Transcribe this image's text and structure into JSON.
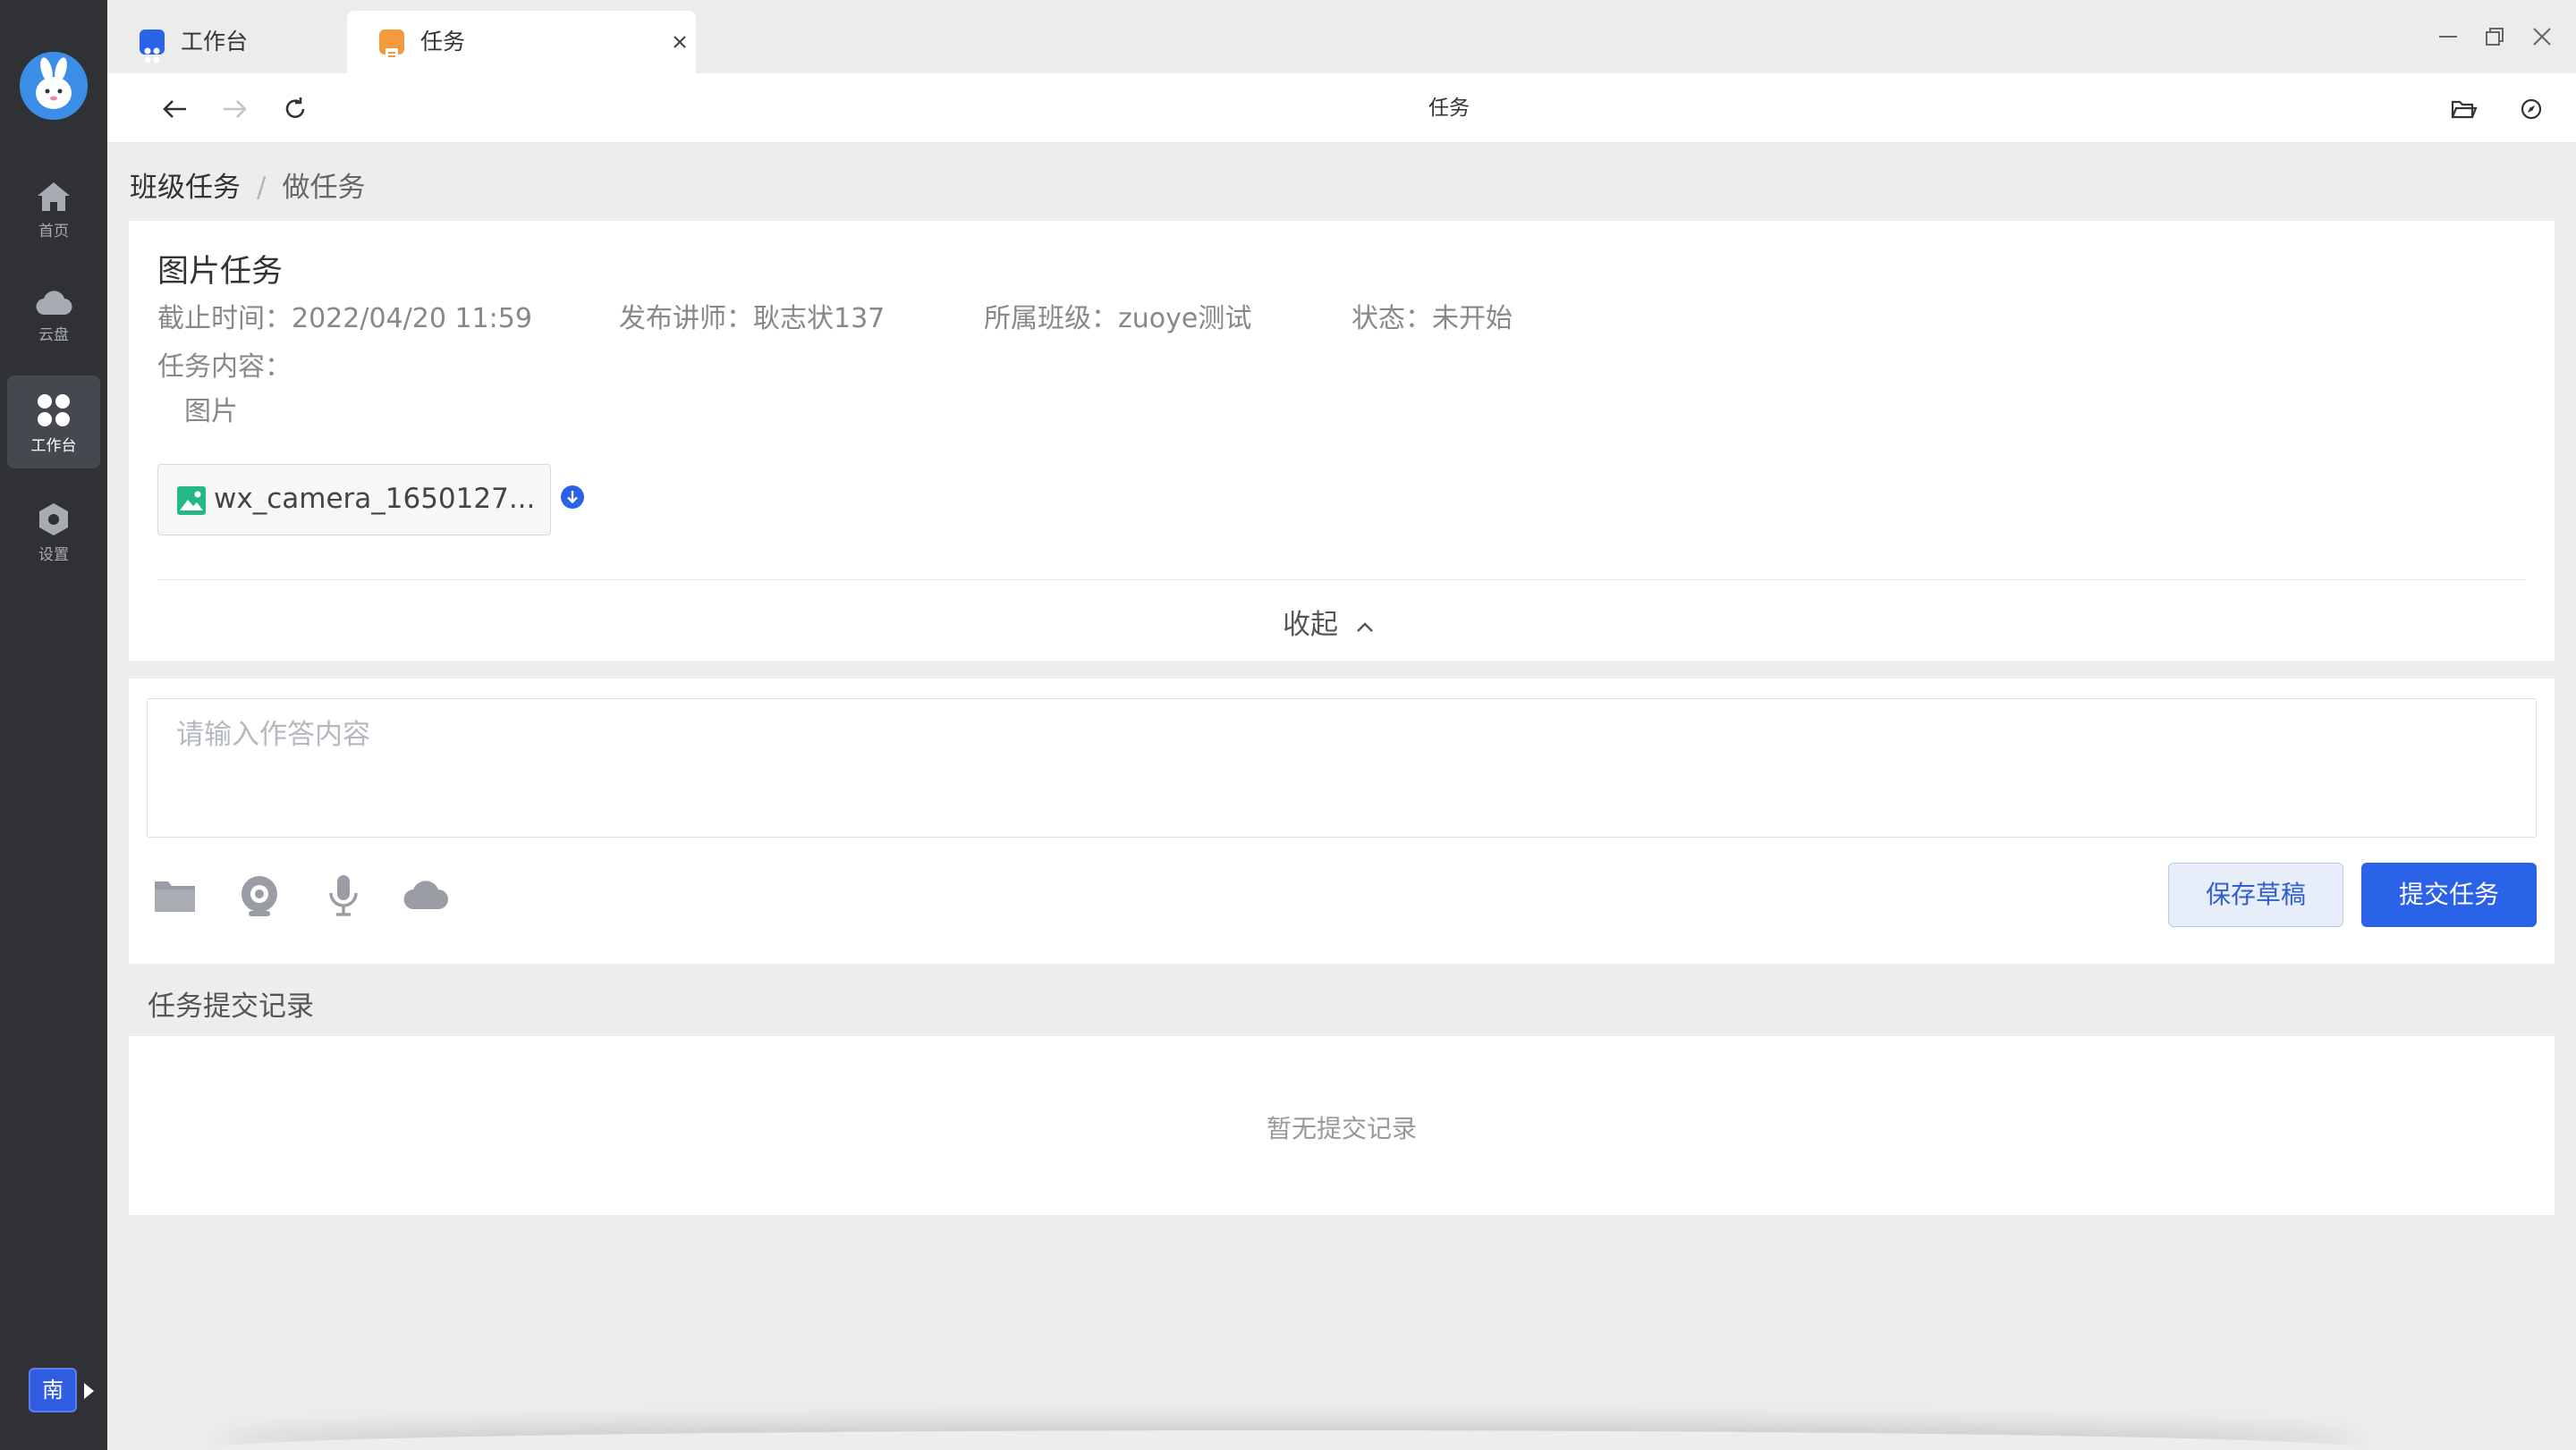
{
  "sidebar": {
    "items": [
      {
        "label": "首页",
        "icon": "home-icon"
      },
      {
        "label": "云盘",
        "icon": "cloud-icon"
      },
      {
        "label": "工作台",
        "icon": "grid-icon",
        "active": true
      },
      {
        "label": "设置",
        "icon": "settings-icon"
      }
    ],
    "user_initial": "南"
  },
  "tabs": [
    {
      "label": "工作台",
      "icon": "workbench-tab-icon",
      "color": "#2a62e8"
    },
    {
      "label": "任务",
      "icon": "task-tab-icon",
      "color": "#f39a3d",
      "active": true
    }
  ],
  "address_bar": {
    "title": "任务"
  },
  "breadcrumb": {
    "parent": "班级任务",
    "separator": "/",
    "current": "做任务"
  },
  "task": {
    "title": "图片任务",
    "deadline": "截止时间：2022/04/20 11:59",
    "teacher": "发布讲师：耿志状137",
    "class": "所属班级：zuoye测试",
    "status": "状态：未开始",
    "content_label": "任务内容：",
    "content_text": "图片",
    "attachment_name": "wx_camera_1650127...",
    "collapse_label": "收起"
  },
  "answer": {
    "placeholder": "请输入作答内容",
    "value": "",
    "tools": [
      "folder-icon",
      "camera-icon",
      "microphone-icon",
      "cloud-upload-icon"
    ],
    "save_draft_label": "保存草稿",
    "submit_label": "提交任务"
  },
  "records": {
    "title": "任务提交记录",
    "empty_text": "暂无提交记录"
  },
  "colors": {
    "sidebar_bg": "#2f3135",
    "accent": "#2a62e8",
    "page_bg": "#ededed"
  }
}
